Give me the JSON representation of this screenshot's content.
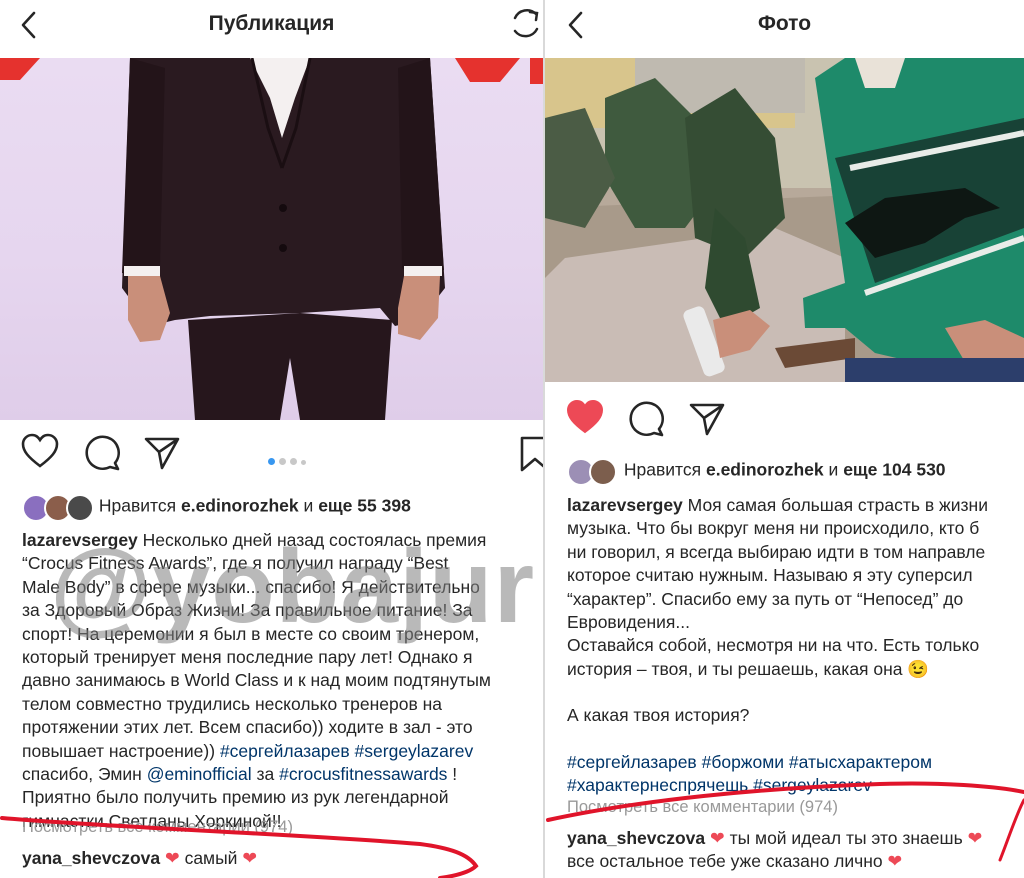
{
  "left": {
    "title": "Публикация",
    "likes": {
      "prefix": "Нравится",
      "user": "e.edinorozhek",
      "connector": "и",
      "more": "еще 55 398"
    },
    "caption": {
      "author": "lazarevsergey",
      "line1": "Несколько дней назад состоялась премия",
      "line2": "“Crocus Fitness Awards”, где я получил награду “Best",
      "line3": "Male Body” в сфере музыки... спасибо! Я действительно",
      "line4": "за Здоровый Образ Жизни! За правильное питание! За",
      "line5": "спорт! На церемонии я был в месте со своим тренером,",
      "line6": "который тренирует меня последние пару лет! Однако я",
      "line7": "давно занимаюсь в World Class и к над моим подтянутым",
      "line8": "телом  совместно трудились несколько тренеров на",
      "line9": "протяжении этих лет. Всем спасибо)) ходите в зал - это",
      "line10_text": "повышает настроение)) ",
      "tag1": "#сергейлазарев",
      "tag2": "#sergeylazarev",
      "line11_a": "спасибо, Эмин  ",
      "mention": "@eminofficial",
      "line11_b": " за ",
      "tag3": "#crocusfitnessawards",
      "line11_c": " !",
      "line12": "Приятно было получить премию из рук легендарной",
      "line13": "гимнастки Светланы Хоркиной!!"
    },
    "view_all": "Посмотреть все комментарии (974)",
    "comment": {
      "user": "yana_shevczova",
      "text": "самый"
    }
  },
  "right": {
    "title": "Фото",
    "likes": {
      "prefix": "Нравится",
      "user": "e.edinorozhek",
      "connector": "и",
      "more": "еще 104 530"
    },
    "caption": {
      "author": "lazarevsergey",
      "line1": "Моя самая большая страсть в жизни",
      "line2": "музыка. Что бы вокруг меня ни происходило, кто б",
      "line3": "ни говорил, я всегда выбираю идти в том направле",
      "line4": "которое считаю нужным. Называю я эту суперсил",
      "line5": "“характер”. Спасибо ему за путь от “Непосед” до",
      "line6": "Евровидения...",
      "line7": "Оставайся собой, несмотря ни на что. Есть только",
      "line8": "история – твоя, и ты решаешь, какая она 😉",
      "line9": "А какая твоя история?",
      "tags1": "#сергейлазарев #боржоми #атысхарактером",
      "tags2": "#характернеспрячешь #sergeylazarev"
    },
    "view_all": "Посмотреть все комментарии (974)",
    "comment": {
      "user": "yana_shevczova",
      "text": "ты мой идеал ты это знаешь",
      "line2": "все остальное тебе уже сказано лично"
    }
  },
  "watermark": "@yobajur",
  "colors": {
    "like_red": "#ed4956",
    "hashtag": "#003569",
    "muted": "#999999",
    "annotation_red": "#e0142a"
  }
}
